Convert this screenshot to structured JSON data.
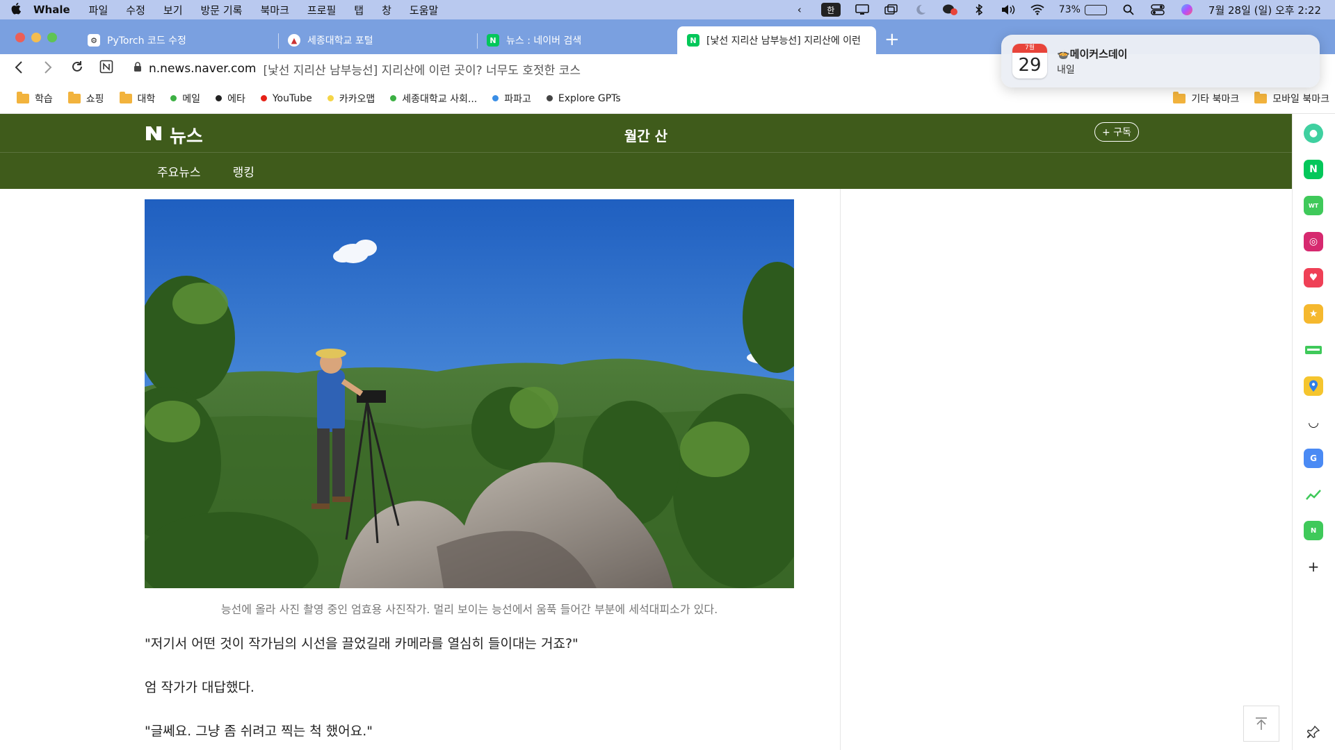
{
  "menubar": {
    "app_name": "Whale",
    "items": [
      "파일",
      "수정",
      "보기",
      "방문 기록",
      "북마크",
      "프로필",
      "탭",
      "창",
      "도움말"
    ],
    "input_method": "한",
    "battery": "73%",
    "battery_level": 0.73,
    "datetime": "7월 28일 (일) 오후 2:22"
  },
  "tabs": [
    {
      "title": "PyTorch 코드 수정",
      "icon": "chatgpt-icon"
    },
    {
      "title": "세종대학교 포털",
      "icon": "sejong-icon"
    },
    {
      "title": "뉴스 : 네이버 검색",
      "icon": "naver-icon"
    },
    {
      "title": "[낯선 지리산 남부능선] 지리산에 이런",
      "icon": "naver-icon"
    }
  ],
  "address": {
    "host": "n.news.naver.com",
    "title": "[낯선 지리산 남부능선] 지리산에 이런 곳이? 너무도 호젓한 코스"
  },
  "bookmarks": [
    {
      "label": "학습",
      "type": "folder"
    },
    {
      "label": "쇼핑",
      "type": "folder"
    },
    {
      "label": "대학",
      "type": "folder"
    },
    {
      "label": "메일",
      "type": "dot",
      "color": "#3cb043"
    },
    {
      "label": "에타",
      "type": "dot",
      "color": "#222222"
    },
    {
      "label": "YouTube",
      "type": "dot",
      "color": "#e62117"
    },
    {
      "label": "카카오맵",
      "type": "dot",
      "color": "#f5d547"
    },
    {
      "label": "세종대학교 사회...",
      "type": "dot",
      "color": "#3cb043"
    },
    {
      "label": "파파고",
      "type": "dot",
      "color": "#3a8ee6"
    },
    {
      "label": "Explore GPTs",
      "type": "dot",
      "color": "#444444"
    }
  ],
  "bookmarks_right": [
    "기타 북마크",
    "모바일 북마크"
  ],
  "naver": {
    "logo_text": "뉴스",
    "press_title": "월간 산",
    "subscribe": "+ 구독",
    "nav": [
      "주요뉴스",
      "랭킹"
    ]
  },
  "article": {
    "caption": "능선에 올라 사진 촬영 중인 엄효용 사진작가. 멀리 보이는 능선에서 움푹 들어간 부분에 세석대피소가 있다.",
    "paragraphs": [
      "\"저기서 어떤 것이 작가님의 시선을 끌었길래 카메라를 열심히 들이대는 거죠?\"",
      "엄 작가가 대답했다.",
      "\"글쎄요. 그냥 좀 쉬려고 찍는 척 했어요.\""
    ]
  },
  "notification": {
    "cal_month": "7월",
    "cal_day": "29",
    "title": "🍲메이커스데이",
    "subtitle": "내일"
  },
  "colors": {
    "naver_green": "#3f5b1b",
    "tabbar_blue": "#7aa0e0",
    "menubar_blue": "#b9c9ef"
  }
}
